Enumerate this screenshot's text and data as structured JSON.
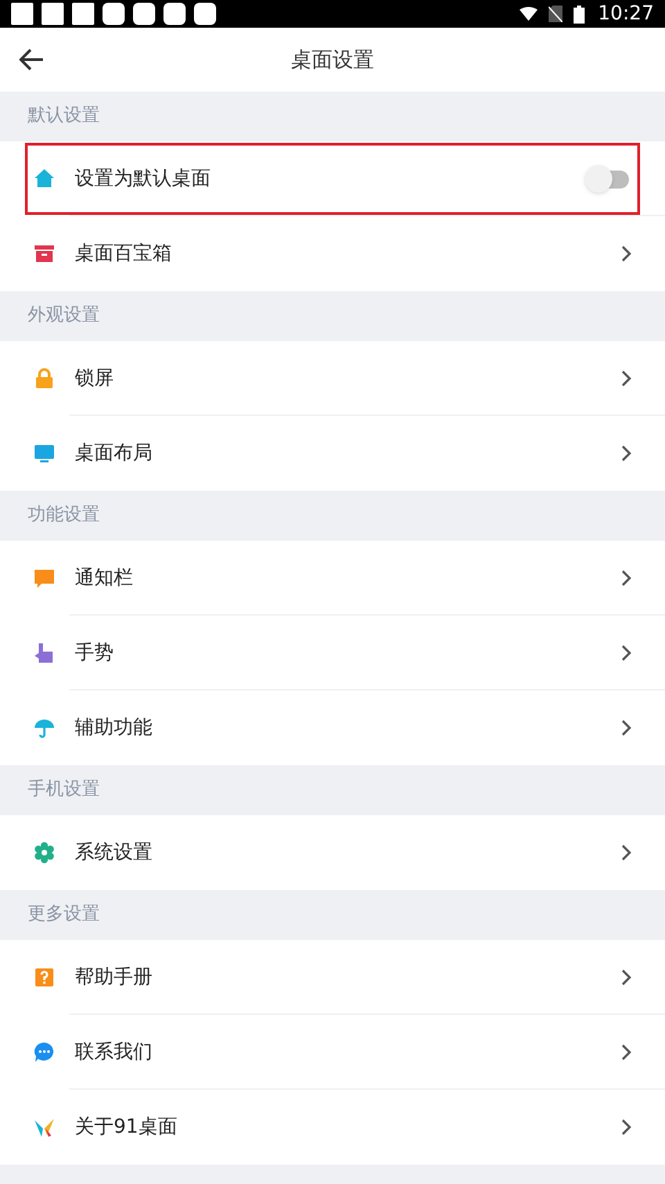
{
  "status_bar": {
    "time": "10:27"
  },
  "header": {
    "title": "桌面设置"
  },
  "sections": [
    {
      "title": "默认设置",
      "items": [
        {
          "label": "设置为默认桌面",
          "kind": "toggle",
          "on": false,
          "highlighted": true
        },
        {
          "label": "桌面百宝箱",
          "kind": "link",
          "highlighted": false
        }
      ]
    },
    {
      "title": "外观设置",
      "items": [
        {
          "label": "锁屏",
          "kind": "link",
          "highlighted": false
        },
        {
          "label": "桌面布局",
          "kind": "link",
          "highlighted": false
        }
      ]
    },
    {
      "title": "功能设置",
      "items": [
        {
          "label": "通知栏",
          "kind": "link",
          "highlighted": false
        },
        {
          "label": "手势",
          "kind": "link",
          "highlighted": false
        },
        {
          "label": "辅助功能",
          "kind": "link",
          "highlighted": false
        }
      ]
    },
    {
      "title": "手机设置",
      "items": [
        {
          "label": "系统设置",
          "kind": "link",
          "highlighted": false
        }
      ]
    },
    {
      "title": "更多设置",
      "items": [
        {
          "label": "帮助手册",
          "kind": "link",
          "highlighted": false
        },
        {
          "label": "联系我们",
          "kind": "link",
          "highlighted": false
        },
        {
          "label": "关于91桌面",
          "kind": "link",
          "highlighted": false
        }
      ]
    }
  ]
}
